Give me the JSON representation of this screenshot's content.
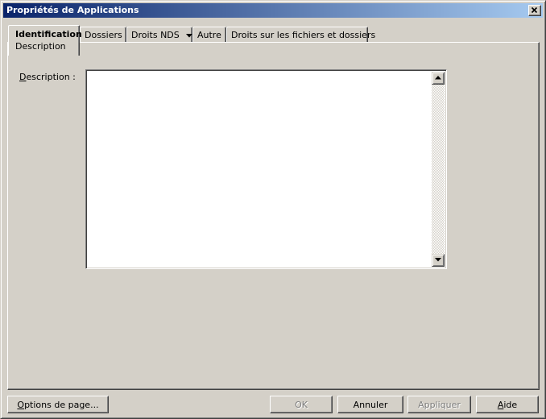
{
  "window": {
    "title": "Propriétés de Applications"
  },
  "tabs": [
    {
      "label": "Identification",
      "sub": "Description",
      "active": true
    },
    {
      "label": "Dossiers"
    },
    {
      "label": "Droits NDS",
      "has_dropdown": true
    },
    {
      "label": "Autre"
    },
    {
      "label": "Droits sur les fichiers et dossiers"
    }
  ],
  "panel": {
    "description_label_pre": "D",
    "description_label_rest": "escription :",
    "description_value": ""
  },
  "buttons": {
    "page_options_pre": "O",
    "page_options_rest": "ptions de page...",
    "ok": "OK",
    "cancel": "Annuler",
    "apply": "Appliquer",
    "help_pre": "A",
    "help_rest": "ide"
  },
  "icons": {
    "close": "close-icon",
    "dropdown": "dropdown-arrow-icon",
    "scroll_up": "scroll-up-arrow-icon",
    "scroll_down": "scroll-down-arrow-icon"
  }
}
